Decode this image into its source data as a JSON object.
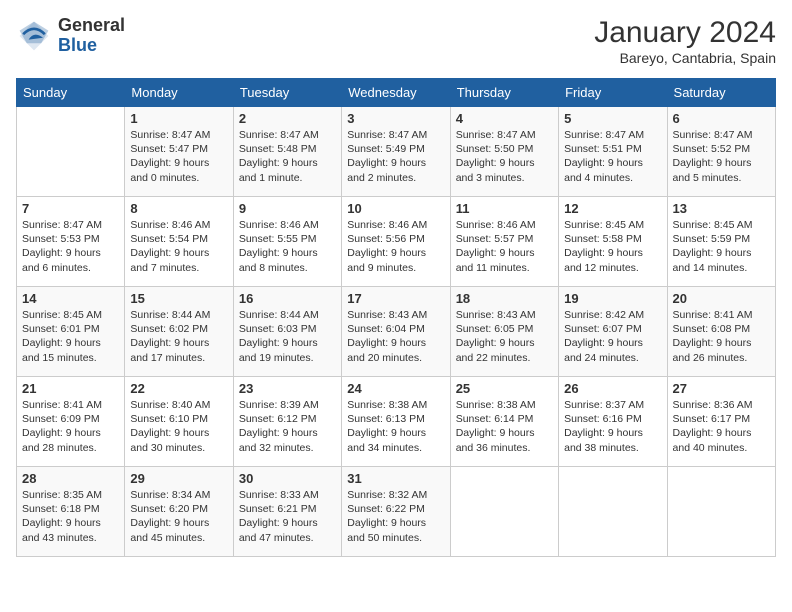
{
  "header": {
    "logo_general": "General",
    "logo_blue": "Blue",
    "month_title": "January 2024",
    "location": "Bareyo, Cantabria, Spain"
  },
  "weekdays": [
    "Sunday",
    "Monday",
    "Tuesday",
    "Wednesday",
    "Thursday",
    "Friday",
    "Saturday"
  ],
  "weeks": [
    [
      {
        "day": "",
        "info": ""
      },
      {
        "day": "1",
        "info": "Sunrise: 8:47 AM\nSunset: 5:47 PM\nDaylight: 9 hours\nand 0 minutes."
      },
      {
        "day": "2",
        "info": "Sunrise: 8:47 AM\nSunset: 5:48 PM\nDaylight: 9 hours\nand 1 minute."
      },
      {
        "day": "3",
        "info": "Sunrise: 8:47 AM\nSunset: 5:49 PM\nDaylight: 9 hours\nand 2 minutes."
      },
      {
        "day": "4",
        "info": "Sunrise: 8:47 AM\nSunset: 5:50 PM\nDaylight: 9 hours\nand 3 minutes."
      },
      {
        "day": "5",
        "info": "Sunrise: 8:47 AM\nSunset: 5:51 PM\nDaylight: 9 hours\nand 4 minutes."
      },
      {
        "day": "6",
        "info": "Sunrise: 8:47 AM\nSunset: 5:52 PM\nDaylight: 9 hours\nand 5 minutes."
      }
    ],
    [
      {
        "day": "7",
        "info": "Sunrise: 8:47 AM\nSunset: 5:53 PM\nDaylight: 9 hours\nand 6 minutes."
      },
      {
        "day": "8",
        "info": "Sunrise: 8:46 AM\nSunset: 5:54 PM\nDaylight: 9 hours\nand 7 minutes."
      },
      {
        "day": "9",
        "info": "Sunrise: 8:46 AM\nSunset: 5:55 PM\nDaylight: 9 hours\nand 8 minutes."
      },
      {
        "day": "10",
        "info": "Sunrise: 8:46 AM\nSunset: 5:56 PM\nDaylight: 9 hours\nand 9 minutes."
      },
      {
        "day": "11",
        "info": "Sunrise: 8:46 AM\nSunset: 5:57 PM\nDaylight: 9 hours\nand 11 minutes."
      },
      {
        "day": "12",
        "info": "Sunrise: 8:45 AM\nSunset: 5:58 PM\nDaylight: 9 hours\nand 12 minutes."
      },
      {
        "day": "13",
        "info": "Sunrise: 8:45 AM\nSunset: 5:59 PM\nDaylight: 9 hours\nand 14 minutes."
      }
    ],
    [
      {
        "day": "14",
        "info": "Sunrise: 8:45 AM\nSunset: 6:01 PM\nDaylight: 9 hours\nand 15 minutes."
      },
      {
        "day": "15",
        "info": "Sunrise: 8:44 AM\nSunset: 6:02 PM\nDaylight: 9 hours\nand 17 minutes."
      },
      {
        "day": "16",
        "info": "Sunrise: 8:44 AM\nSunset: 6:03 PM\nDaylight: 9 hours\nand 19 minutes."
      },
      {
        "day": "17",
        "info": "Sunrise: 8:43 AM\nSunset: 6:04 PM\nDaylight: 9 hours\nand 20 minutes."
      },
      {
        "day": "18",
        "info": "Sunrise: 8:43 AM\nSunset: 6:05 PM\nDaylight: 9 hours\nand 22 minutes."
      },
      {
        "day": "19",
        "info": "Sunrise: 8:42 AM\nSunset: 6:07 PM\nDaylight: 9 hours\nand 24 minutes."
      },
      {
        "day": "20",
        "info": "Sunrise: 8:41 AM\nSunset: 6:08 PM\nDaylight: 9 hours\nand 26 minutes."
      }
    ],
    [
      {
        "day": "21",
        "info": "Sunrise: 8:41 AM\nSunset: 6:09 PM\nDaylight: 9 hours\nand 28 minutes."
      },
      {
        "day": "22",
        "info": "Sunrise: 8:40 AM\nSunset: 6:10 PM\nDaylight: 9 hours\nand 30 minutes."
      },
      {
        "day": "23",
        "info": "Sunrise: 8:39 AM\nSunset: 6:12 PM\nDaylight: 9 hours\nand 32 minutes."
      },
      {
        "day": "24",
        "info": "Sunrise: 8:38 AM\nSunset: 6:13 PM\nDaylight: 9 hours\nand 34 minutes."
      },
      {
        "day": "25",
        "info": "Sunrise: 8:38 AM\nSunset: 6:14 PM\nDaylight: 9 hours\nand 36 minutes."
      },
      {
        "day": "26",
        "info": "Sunrise: 8:37 AM\nSunset: 6:16 PM\nDaylight: 9 hours\nand 38 minutes."
      },
      {
        "day": "27",
        "info": "Sunrise: 8:36 AM\nSunset: 6:17 PM\nDaylight: 9 hours\nand 40 minutes."
      }
    ],
    [
      {
        "day": "28",
        "info": "Sunrise: 8:35 AM\nSunset: 6:18 PM\nDaylight: 9 hours\nand 43 minutes."
      },
      {
        "day": "29",
        "info": "Sunrise: 8:34 AM\nSunset: 6:20 PM\nDaylight: 9 hours\nand 45 minutes."
      },
      {
        "day": "30",
        "info": "Sunrise: 8:33 AM\nSunset: 6:21 PM\nDaylight: 9 hours\nand 47 minutes."
      },
      {
        "day": "31",
        "info": "Sunrise: 8:32 AM\nSunset: 6:22 PM\nDaylight: 9 hours\nand 50 minutes."
      },
      {
        "day": "",
        "info": ""
      },
      {
        "day": "",
        "info": ""
      },
      {
        "day": "",
        "info": ""
      }
    ]
  ]
}
